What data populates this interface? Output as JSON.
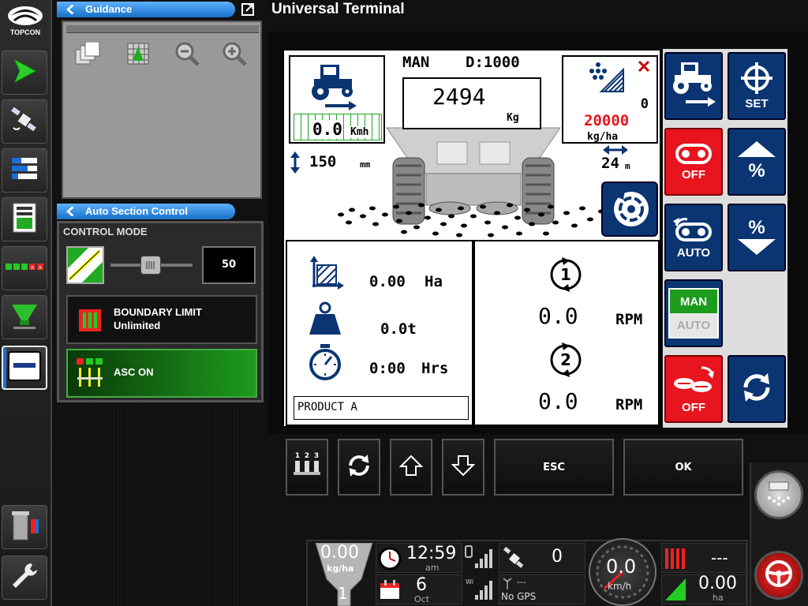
{
  "brand": {
    "logo_text": "TOPCON"
  },
  "sidebar": {
    "items": [
      {
        "icon": "guidance-arrow-icon",
        "active": false
      },
      {
        "icon": "satellite-icon",
        "active": false
      },
      {
        "icon": "layers-icon",
        "active": false
      },
      {
        "icon": "implement-screen-icon",
        "active": false
      },
      {
        "icon": "sections-icon",
        "active": false
      },
      {
        "icon": "spreader-funnel-icon",
        "active": false
      },
      {
        "icon": "universal-terminal-icon",
        "active": true
      },
      {
        "icon": "trash-icon",
        "active": false
      },
      {
        "icon": "wrench-icon",
        "active": false
      }
    ]
  },
  "guidance": {
    "title": "Guidance",
    "tools": [
      "layers-icon",
      "grid-map-icon",
      "zoom-out-icon",
      "zoom-in-icon"
    ]
  },
  "asc": {
    "title": "Auto Section Control",
    "control_mode_label": "CONTROL MODE",
    "slider_value": "50",
    "boundary_title": "BOUNDARY LIMIT",
    "boundary_value": "Unlimited",
    "asc_label": "ASC ON"
  },
  "ut": {
    "title": "Universal Terminal",
    "mode": "MAN",
    "d_label": "D:1000",
    "speed": "0.0",
    "speed_unit": "Kmh",
    "weight": "2494",
    "weight_unit": "Kg",
    "rate_actual": "0",
    "rate_target": "20000",
    "rate_unit": "kg/ha",
    "height": "150",
    "height_unit": "mm",
    "width": "24",
    "width_unit": "m",
    "area": "0.00",
    "area_unit": "Ha",
    "tonnage": "0.0t",
    "time": "0:00",
    "time_unit": "Hrs",
    "product": "PRODUCT A",
    "disc1_label": "1",
    "disc1_rpm": "0.0",
    "disc2_label": "2",
    "disc2_rpm": "0.0",
    "rpm_unit": "RPM",
    "softkeys": {
      "set": "SET",
      "off1": "OFF",
      "pct_up": "%",
      "auto": "AUTO",
      "pct_down": "%",
      "man": "MAN",
      "auto2": "AUTO",
      "off2": "OFF"
    },
    "function_keys": {
      "esc": "ESC",
      "ok": "OK"
    }
  },
  "status": {
    "rate": "0.00",
    "rate_unit": "kg/ha",
    "product_num": "1",
    "time": "12:59",
    "ampm": "am",
    "day": "6",
    "month": "Oct",
    "sat_count": "0",
    "gps_dash": "---",
    "gps_status": "No GPS",
    "speed": "0.0",
    "speed_unit": "km/h",
    "top_right": "---",
    "area": "0.00",
    "area_unit": "ha"
  },
  "colors": {
    "navy": "#0a3572",
    "red": "#e8141e",
    "panel_blue": "#1570c8",
    "green": "#1d9b1d"
  }
}
